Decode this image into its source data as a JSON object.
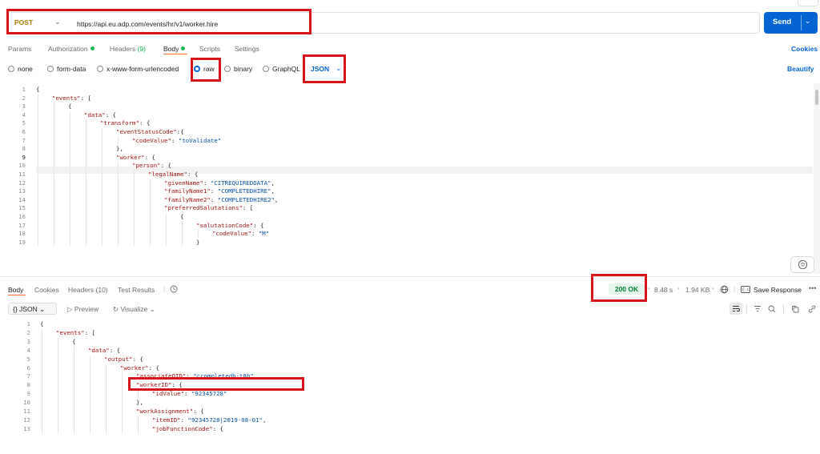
{
  "request": {
    "method": "POST",
    "url": "https://api.eu.adp.com/events/hr/v1/worker.hire",
    "send_label": "Send"
  },
  "request_tabs": [
    {
      "label": "Params"
    },
    {
      "label": "Authorization"
    },
    {
      "label": "Headers",
      "count": "(9)"
    },
    {
      "label": "Body"
    },
    {
      "label": "Scripts"
    },
    {
      "label": "Settings"
    }
  ],
  "cookies_label": "Cookies",
  "body_types": [
    {
      "label": "none"
    },
    {
      "label": "form-data"
    },
    {
      "label": "x-www-form-urlencoded"
    },
    {
      "label": "raw"
    },
    {
      "label": "binary"
    },
    {
      "label": "GraphQL"
    }
  ],
  "selected_body_type": "raw",
  "language": "JSON",
  "beautify_label": "Beautify",
  "request_lines": [
    {
      "n": "1",
      "indent": 0,
      "t": [
        [
          "{",
          "p"
        ]
      ]
    },
    {
      "n": "2",
      "indent": 1,
      "t": [
        [
          "\"events\"",
          "k"
        ],
        [
          ": [",
          "p"
        ]
      ]
    },
    {
      "n": "3",
      "indent": 2,
      "t": [
        [
          "{",
          "p"
        ]
      ]
    },
    {
      "n": "4",
      "indent": 3,
      "t": [
        [
          "\"data\"",
          "k"
        ],
        [
          ": {",
          "p"
        ]
      ]
    },
    {
      "n": "5",
      "indent": 4,
      "t": [
        [
          "\"transform\"",
          "k"
        ],
        [
          ": {",
          "p"
        ]
      ]
    },
    {
      "n": "6",
      "indent": 5,
      "t": [
        [
          "\"eventStatusCode\"",
          "k"
        ],
        [
          ":{",
          "p"
        ]
      ]
    },
    {
      "n": "7",
      "indent": 6,
      "t": [
        [
          "\"codeValue\"",
          "k"
        ],
        [
          ": ",
          "p"
        ],
        [
          "\"toValidate\"",
          "s"
        ]
      ]
    },
    {
      "n": "8",
      "indent": 5,
      "t": [
        [
          "},",
          "p"
        ]
      ]
    },
    {
      "n": "9",
      "indent": 5,
      "t": [
        [
          "\"worker\"",
          "k"
        ],
        [
          ": {",
          "p"
        ]
      ]
    },
    {
      "n": "10",
      "indent": 6,
      "t": [
        [
          "\"person\"",
          "k"
        ],
        [
          ": {",
          "p"
        ]
      ]
    },
    {
      "n": "11",
      "indent": 7,
      "t": [
        [
          "\"legalName\"",
          "k"
        ],
        [
          ": {",
          "p"
        ]
      ]
    },
    {
      "n": "12",
      "indent": 8,
      "t": [
        [
          "\"givenName\"",
          "k"
        ],
        [
          ": ",
          "p"
        ],
        [
          "\"CITREQUIREDDATA\"",
          "s"
        ],
        [
          ",",
          "p"
        ]
      ]
    },
    {
      "n": "13",
      "indent": 8,
      "t": [
        [
          "\"familyName1\"",
          "k"
        ],
        [
          ": ",
          "p"
        ],
        [
          "\"COMPLETEDHIRE\"",
          "s"
        ],
        [
          ",",
          "p"
        ]
      ]
    },
    {
      "n": "14",
      "indent": 8,
      "t": [
        [
          "\"familyName2\"",
          "k"
        ],
        [
          ": ",
          "p"
        ],
        [
          "\"COMPLETEDHIRE2\"",
          "s"
        ],
        [
          ",",
          "p"
        ]
      ]
    },
    {
      "n": "15",
      "indent": 8,
      "t": [
        [
          "\"preferredSalutations\"",
          "k"
        ],
        [
          ": [",
          "p"
        ]
      ]
    },
    {
      "n": "16",
      "indent": 9,
      "t": [
        [
          "{",
          "p"
        ]
      ]
    },
    {
      "n": "17",
      "indent": 10,
      "t": [
        [
          "\"salutationCode\"",
          "k"
        ],
        [
          ": {",
          "p"
        ]
      ]
    },
    {
      "n": "18",
      "indent": 11,
      "t": [
        [
          "\"codeValue\"",
          "k"
        ],
        [
          ": ",
          "p"
        ],
        [
          "\"M\"",
          "s"
        ]
      ]
    },
    {
      "n": "19",
      "indent": 10,
      "t": [
        [
          "}",
          "p"
        ]
      ]
    }
  ],
  "response_tabs": [
    {
      "label": "Body"
    },
    {
      "label": "Cookies"
    },
    {
      "label": "Headers",
      "count": "(10)"
    },
    {
      "label": "Test Results"
    }
  ],
  "response_meta": {
    "status": "200 OK",
    "time": "8.48 s",
    "size": "1.94 KB",
    "save_label": "Save Response",
    "format": "{} JSON",
    "preview_label": "Preview",
    "visualize_label": "Visualize"
  },
  "response_lines": [
    {
      "n": "1",
      "indent": 0,
      "t": [
        [
          "{",
          "p"
        ]
      ]
    },
    {
      "n": "2",
      "indent": 1,
      "t": [
        [
          "\"events\"",
          "k"
        ],
        [
          ": [",
          "p"
        ]
      ]
    },
    {
      "n": "3",
      "indent": 2,
      "t": [
        [
          "{",
          "p"
        ]
      ]
    },
    {
      "n": "4",
      "indent": 3,
      "t": [
        [
          "\"data\"",
          "k"
        ],
        [
          ": {",
          "p"
        ]
      ]
    },
    {
      "n": "5",
      "indent": 4,
      "t": [
        [
          "\"output\"",
          "k"
        ],
        [
          ": {",
          "p"
        ]
      ]
    },
    {
      "n": "6",
      "indent": 5,
      "t": [
        [
          "\"worker\"",
          "k"
        ],
        [
          ": {",
          "p"
        ]
      ]
    },
    {
      "n": "7",
      "indent": 6,
      "t": [
        [
          "\"associateOID\"",
          "k"
        ],
        [
          ": ",
          "p"
        ],
        [
          "\"ccompletedh-t8h\"",
          "s"
        ],
        [
          ",",
          "p"
        ]
      ]
    },
    {
      "n": "8",
      "indent": 6,
      "t": [
        [
          "\"workerID\"",
          "k"
        ],
        [
          ": {",
          "p"
        ]
      ]
    },
    {
      "n": "9",
      "indent": 7,
      "t": [
        [
          "\"idValue\"",
          "k"
        ],
        [
          ": ",
          "p"
        ],
        [
          "\"92345728\"",
          "s"
        ]
      ]
    },
    {
      "n": "10",
      "indent": 6,
      "t": [
        [
          "},",
          "p"
        ]
      ]
    },
    {
      "n": "11",
      "indent": 6,
      "t": [
        [
          "\"workAssignment\"",
          "k"
        ],
        [
          ": {",
          "p"
        ]
      ]
    },
    {
      "n": "12",
      "indent": 7,
      "t": [
        [
          "\"itemID\"",
          "k"
        ],
        [
          ": ",
          "p"
        ],
        [
          "\"92345728|2019-08-01\"",
          "s"
        ],
        [
          ",",
          "p"
        ]
      ]
    },
    {
      "n": "13",
      "indent": 7,
      "t": [
        [
          "\"jobFunctionCode\"",
          "k"
        ],
        [
          ": {",
          "p"
        ]
      ]
    }
  ],
  "colors": {
    "accent": "#0265d2",
    "method": "#ad7a03",
    "ok_green": "#0cbb52",
    "highlight_box": "#d8141b",
    "json_key": "#a31515",
    "json_string": "#0451a5"
  },
  "icons": [
    "chevron-down-icon",
    "history-icon",
    "globe-icon",
    "example-icon",
    "more-icon",
    "wrap-icon",
    "filter-icon",
    "search-icon",
    "copy-icon",
    "link-icon",
    "ai-assistant-icon",
    "play-icon",
    "visualize-icon"
  ]
}
